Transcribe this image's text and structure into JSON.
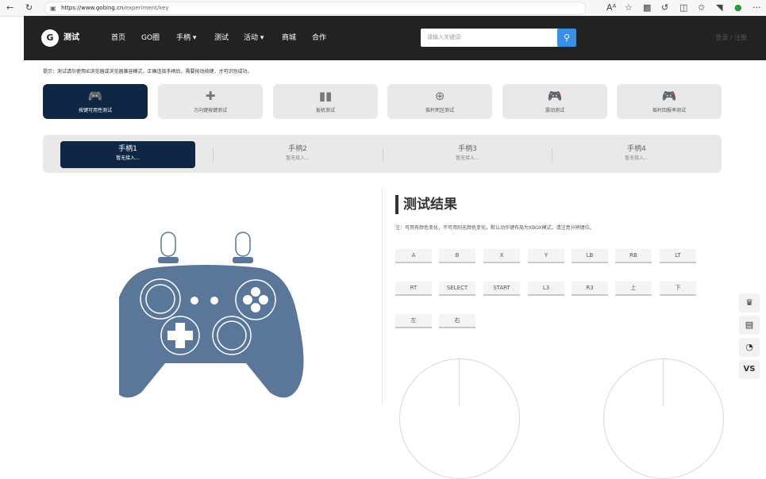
{
  "browser": {
    "back_icon": "arrow-left-icon",
    "refresh_icon": "refresh-icon",
    "url_domain": "https://www.gobing.cn",
    "url_path": "/experiment/key",
    "reader_label": "Aᴬ",
    "ellipsis": "···"
  },
  "nav": {
    "logo_text": "测试",
    "items": [
      "首页",
      "GO圈",
      "手柄 ▾",
      "测试",
      "活动 ▾",
      "商城",
      "合作"
    ],
    "search_placeholder": "请输入关键词",
    "login": "登录 / 注册"
  },
  "tip": "提示：测试请勿使用IE浏览器或浏览器兼容模式，正确连接手柄后，需要按动按键，才可识别成功。",
  "tests": [
    {
      "label": "按键可用性测试",
      "icon": "gamepad-icon",
      "active": true
    },
    {
      "label": "方向键按键测试",
      "icon": "dpad-icon",
      "active": false
    },
    {
      "label": "扳机测试",
      "icon": "trigger-bars-icon",
      "active": false
    },
    {
      "label": "摇杆死区测试",
      "icon": "crosshair-icon",
      "active": false
    },
    {
      "label": "震动测试",
      "icon": "vibrating-gamepad-icon",
      "active": false
    },
    {
      "label": "摇杆回报率测试",
      "icon": "gamepad-outline-icon",
      "active": false
    }
  ],
  "gamepads": [
    {
      "name": "手柄1",
      "status": "暂无接入...",
      "active": true
    },
    {
      "name": "手柄2",
      "status": "暂无接入...",
      "active": false
    },
    {
      "name": "手柄3",
      "status": "暂无接入...",
      "active": false
    },
    {
      "name": "手柄4",
      "status": "暂无接入...",
      "active": false
    }
  ],
  "result": {
    "title": "测试结果",
    "note": "注：可用有颜色变化，不可用则无颜色变化。默认动作键布局为XBOX模式，请注意分辨键位。",
    "keys": [
      "A",
      "B",
      "X",
      "Y",
      "LB",
      "RB",
      "LT",
      "RT",
      "SELECT",
      "START",
      "L3",
      "R3",
      "上",
      "下",
      "左",
      "右"
    ]
  },
  "side_tools": [
    "hat-icon",
    "clipboard-icon",
    "chat-icon",
    "vs-icon"
  ],
  "side_labels": [
    "♛",
    "▤",
    "◔",
    "VS"
  ],
  "colors": {
    "nav_bg": "#222222",
    "active": "#0f2744",
    "accent": "#3a8ee6",
    "controller": "#5a7699"
  }
}
